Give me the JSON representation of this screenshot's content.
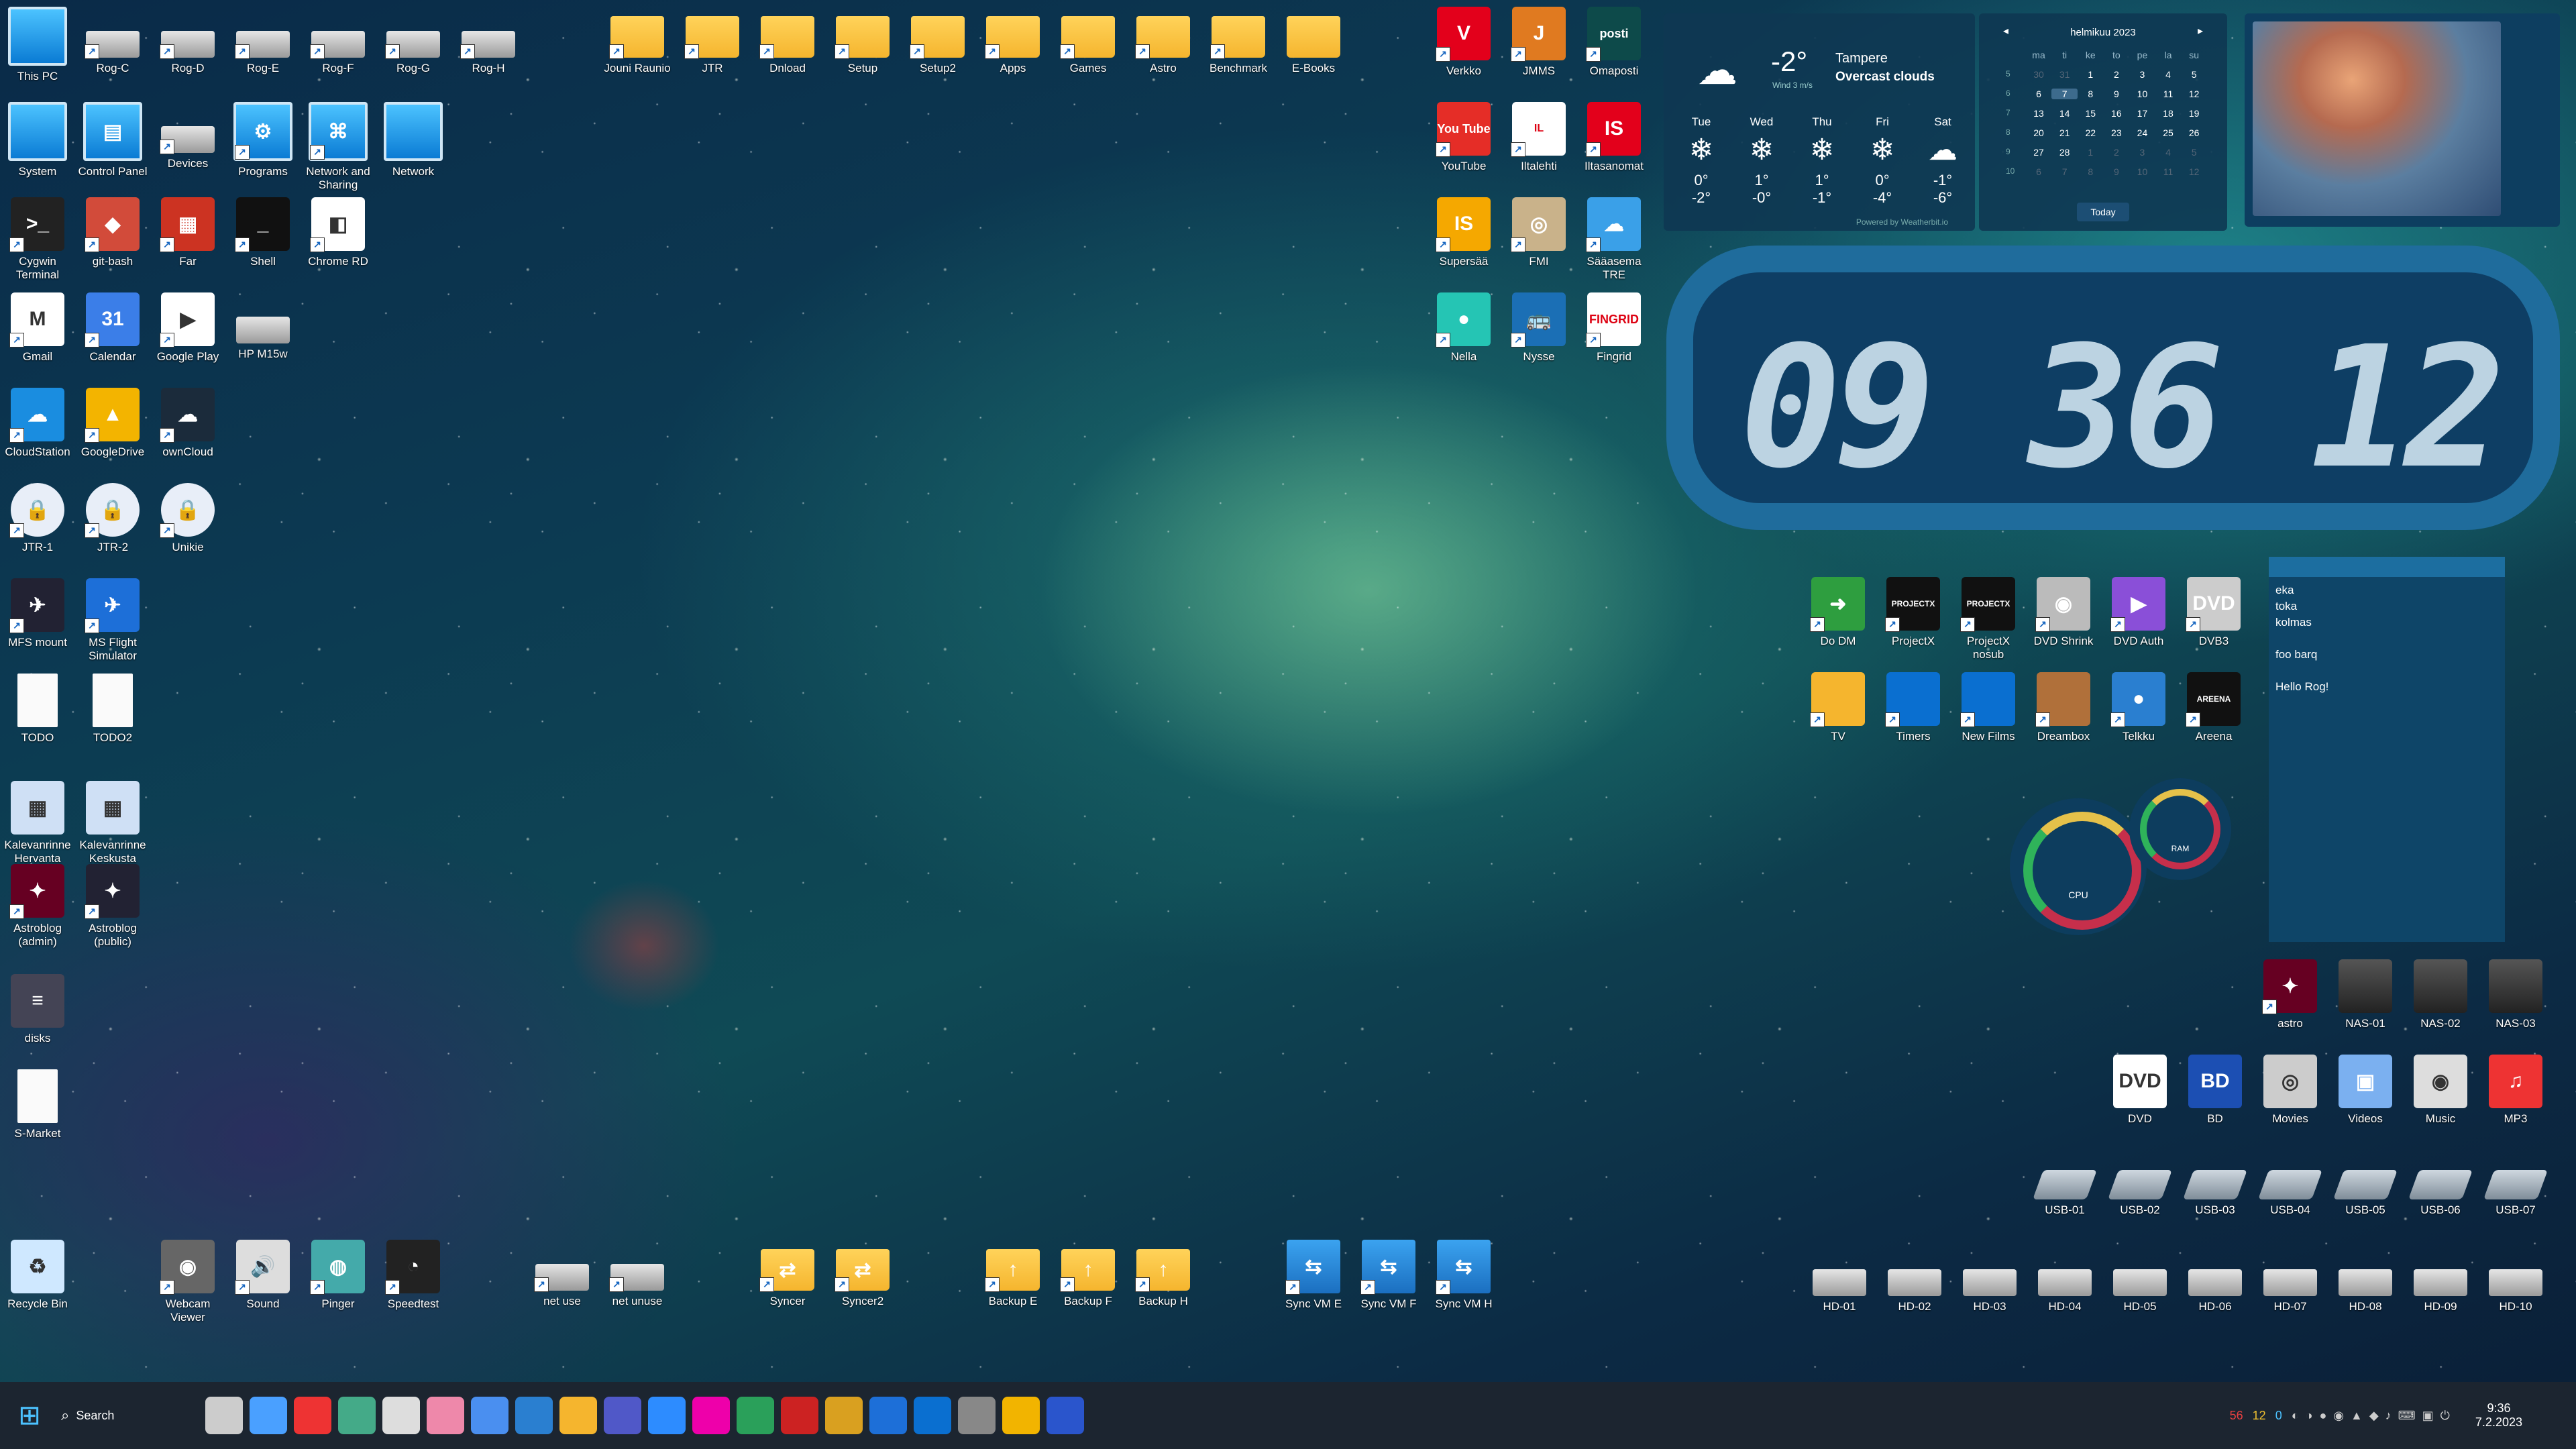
{
  "desktop": {
    "left_icons": [
      {
        "label": "This PC",
        "kind": "monitor",
        "shortcut": false
      },
      {
        "label": "Rog-C",
        "kind": "drive",
        "shortcut": true
      },
      {
        "label": "Rog-D",
        "kind": "drive",
        "shortcut": true
      },
      {
        "label": "Rog-E",
        "kind": "drive",
        "shortcut": true
      },
      {
        "label": "Rog-F",
        "kind": "drive",
        "shortcut": true
      },
      {
        "label": "Rog-G",
        "kind": "drive",
        "shortcut": true
      },
      {
        "label": "Rog-H",
        "kind": "drive",
        "shortcut": true
      },
      {
        "label": "System",
        "kind": "monitor",
        "shortcut": false
      },
      {
        "label": "Control Panel",
        "kind": "panel",
        "shortcut": false
      },
      {
        "label": "Devices",
        "kind": "devices",
        "shortcut": true
      },
      {
        "label": "Programs",
        "kind": "programs",
        "shortcut": true
      },
      {
        "label": "Network and Sharing",
        "kind": "network",
        "shortcut": true
      },
      {
        "label": "Network",
        "kind": "monitor",
        "shortcut": false
      },
      {
        "label": "Cygwin Terminal",
        "kind": "terminal",
        "shortcut": true
      },
      {
        "label": "git-bash",
        "kind": "git",
        "shortcut": true
      },
      {
        "label": "Far",
        "kind": "far",
        "shortcut": true
      },
      {
        "label": "Shell",
        "kind": "shell",
        "shortcut": true
      },
      {
        "label": "Chrome RD",
        "kind": "chromerd",
        "shortcut": true
      },
      {
        "label": "Gmail",
        "kind": "gmail",
        "shortcut": true
      },
      {
        "label": "Calendar",
        "kind": "calendar",
        "shortcut": true
      },
      {
        "label": "Google Play",
        "kind": "play",
        "shortcut": true
      },
      {
        "label": "HP M15w",
        "kind": "printer",
        "shortcut": false
      },
      {
        "label": "CloudStation",
        "kind": "cloud",
        "shortcut": true
      },
      {
        "label": "GoogleDrive",
        "kind": "gdrive",
        "shortcut": true
      },
      {
        "label": "ownCloud",
        "kind": "owncloud",
        "shortcut": true
      },
      {
        "label": "JTR-1",
        "kind": "lock",
        "shortcut": true
      },
      {
        "label": "JTR-2",
        "kind": "lock",
        "shortcut": true
      },
      {
        "label": "Unikie",
        "kind": "lock",
        "shortcut": true
      },
      {
        "label": "MFS mount",
        "kind": "mfs",
        "shortcut": true
      },
      {
        "label": "MS Flight Simulator",
        "kind": "plane",
        "shortcut": true
      },
      {
        "label": "TODO",
        "kind": "doc",
        "shortcut": false
      },
      {
        "label": "TODO2",
        "kind": "doc",
        "shortcut": false
      },
      {
        "label": "Kalevanrinne Hervanta",
        "kind": "sheet",
        "shortcut": false
      },
      {
        "label": "Kalevanrinne Keskusta",
        "kind": "sheet",
        "shortcut": false
      },
      {
        "label": "Astroblog (admin)",
        "kind": "astro",
        "shortcut": true
      },
      {
        "label": "Astroblog (public)",
        "kind": "astro2",
        "shortcut": true
      },
      {
        "label": "disks",
        "kind": "disks",
        "shortcut": false
      },
      {
        "label": "S-Market",
        "kind": "doc",
        "shortcut": false
      }
    ],
    "top_folders": [
      "Jouni Raunio",
      "JTR",
      "Dnload",
      "Setup",
      "Setup2",
      "Apps",
      "Games",
      "Astro",
      "Benchmark",
      "E-Books"
    ],
    "web_icons": [
      {
        "label": "Verkko",
        "text": "V",
        "color": "#e3001b"
      },
      {
        "label": "JMMS",
        "text": "J",
        "color": "#e07a20"
      },
      {
        "label": "Omaposti",
        "text": "posti",
        "color": "#0d4a4a"
      },
      {
        "label": "YouTube",
        "text": "You Tube",
        "color": "#e52d27"
      },
      {
        "label": "Iltalehti",
        "text": "IL",
        "color": "#ffffff"
      },
      {
        "label": "Iltasanomat",
        "text": "IS",
        "color": "#e3001b"
      },
      {
        "label": "Supersää",
        "text": "IS",
        "color": "#f5a800"
      },
      {
        "label": "FMI",
        "text": "◎",
        "color": "#c9b28a"
      },
      {
        "label": "Sääasema TRE",
        "text": "☁",
        "color": "#3aa0e8"
      },
      {
        "label": "Nella",
        "text": "●",
        "color": "#25c5b4"
      },
      {
        "label": "Nysse",
        "text": "🚌",
        "color": "#1b6fb5"
      },
      {
        "label": "Fingrid",
        "text": "FINGRID",
        "color": "#ffffff"
      }
    ],
    "media_icons": [
      {
        "label": "Do DM",
        "text": "➜",
        "color": "#2e9e3f"
      },
      {
        "label": "ProjectX",
        "text": "PROJECTX",
        "color": "#111"
      },
      {
        "label": "ProjectX nosub",
        "text": "PROJECTX",
        "color": "#111"
      },
      {
        "label": "DVD Shrink",
        "text": "◉",
        "color": "#bbb"
      },
      {
        "label": "DVD Auth",
        "text": "▶",
        "color": "#8a4fd8"
      },
      {
        "label": "DVB3",
        "text": "DVD",
        "color": "#ccc"
      },
      {
        "label": "TV",
        "text": "",
        "color": "#f5b52e"
      },
      {
        "label": "Timers",
        "text": "",
        "color": "#0a6fd0"
      },
      {
        "label": "New Films",
        "text": "",
        "color": "#0a6fd0"
      },
      {
        "label": "Dreambox",
        "text": "",
        "color": "#b0703a"
      },
      {
        "label": "Telkku",
        "text": "●",
        "color": "#2a7fd0"
      },
      {
        "label": "Areena",
        "text": "AREENA",
        "color": "#111"
      }
    ],
    "lib_icons": [
      {
        "label": "astro",
        "kind": "astro"
      },
      {
        "label": "NAS-01",
        "kind": "nas"
      },
      {
        "label": "NAS-02",
        "kind": "nas"
      },
      {
        "label": "NAS-03",
        "kind": "nas"
      },
      {
        "label": "DVD",
        "kind": "dvd"
      },
      {
        "label": "BD",
        "kind": "bd"
      },
      {
        "label": "Movies",
        "kind": "movies"
      },
      {
        "label": "Videos",
        "kind": "videos"
      },
      {
        "label": "Music",
        "kind": "music"
      },
      {
        "label": "MP3",
        "kind": "mp3"
      }
    ],
    "usb_icons": [
      "USB-01",
      "USB-02",
      "USB-03",
      "USB-04",
      "USB-05",
      "USB-06",
      "USB-07"
    ],
    "hd_icons": [
      "HD-01",
      "HD-02",
      "HD-03",
      "HD-04",
      "HD-05",
      "HD-06",
      "HD-07",
      "HD-08",
      "HD-09",
      "HD-10"
    ],
    "bottom_left": [
      {
        "label": "Recycle Bin",
        "kind": "recycle"
      },
      {
        "label": "Webcam Viewer",
        "kind": "webcam"
      },
      {
        "label": "Sound",
        "kind": "sound"
      },
      {
        "label": "Pinger",
        "kind": "pinger"
      },
      {
        "label": "Speedtest",
        "kind": "speed"
      }
    ],
    "bottom_mid": [
      {
        "label": "net use",
        "kind": "netuse"
      },
      {
        "label": "net unuse",
        "kind": "netunuse"
      },
      {
        "label": "Syncer",
        "kind": "syncer"
      },
      {
        "label": "Syncer2",
        "kind": "syncer"
      },
      {
        "label": "Backup E",
        "kind": "backup"
      },
      {
        "label": "Backup F",
        "kind": "backup"
      },
      {
        "label": "Backup H",
        "kind": "backup"
      },
      {
        "label": "Sync VM E",
        "kind": "syncvm"
      },
      {
        "label": "Sync VM F",
        "kind": "syncvm"
      },
      {
        "label": "Sync VM H",
        "kind": "syncvm"
      }
    ]
  },
  "weather": {
    "temp": "-2°",
    "city": "Tampere",
    "condition": "Overcast clouds",
    "wind": "Wind 3 m/s",
    "days": [
      {
        "day": "Tue",
        "hi": "0°",
        "lo": "-2°"
      },
      {
        "day": "Wed",
        "hi": "1°",
        "lo": "-0°"
      },
      {
        "day": "Thu",
        "hi": "1°",
        "lo": "-1°"
      },
      {
        "day": "Fri",
        "hi": "0°",
        "lo": "-4°"
      },
      {
        "day": "Sat",
        "hi": "-1°",
        "lo": "-6°"
      }
    ],
    "powered": "Powered by Weatherbit.io"
  },
  "calendar": {
    "month": "helmikuu 2023",
    "weekdays": [
      "ma",
      "ti",
      "ke",
      "to",
      "pe",
      "la",
      "su"
    ],
    "weeks": [
      {
        "wk": "5",
        "days": [
          "30",
          "31",
          "1",
          "2",
          "3",
          "4",
          "5"
        ]
      },
      {
        "wk": "6",
        "days": [
          "6",
          "7",
          "8",
          "9",
          "10",
          "11",
          "12"
        ]
      },
      {
        "wk": "7",
        "days": [
          "13",
          "14",
          "15",
          "16",
          "17",
          "18",
          "19"
        ]
      },
      {
        "wk": "8",
        "days": [
          "20",
          "21",
          "22",
          "23",
          "24",
          "25",
          "26"
        ]
      },
      {
        "wk": "9",
        "days": [
          "27",
          "28",
          "1",
          "2",
          "3",
          "4",
          "5"
        ]
      },
      {
        "wk": "10",
        "days": [
          "6",
          "7",
          "8",
          "9",
          "10",
          "11",
          "12"
        ]
      }
    ],
    "today": "7",
    "today_button": "Today",
    "prev": "◂",
    "next": "▸"
  },
  "clock": {
    "hours": "09",
    "minutes": "36",
    "seconds": "12"
  },
  "notes": {
    "lines": [
      "eka",
      "toka",
      "kolmas",
      "",
      "foo barq",
      "",
      "Hello Rog!"
    ]
  },
  "gauges": {
    "cpu_label": "CPU",
    "ram_label": "RAM",
    "cpu_level": 0.35,
    "ram_level": 0.2
  },
  "taskbar": {
    "search_label": "Search",
    "search_icon": "search-icon",
    "apps": [
      "file-explorer",
      "weather",
      "calendar-app",
      "resource-monitor",
      "clock-app",
      "snipping-tool",
      "notepad",
      "remote-desktop",
      "weather-app",
      "teams",
      "zoom",
      "slack",
      "google-drive",
      "filezilla",
      "foobar",
      "virtualbox",
      "outlook",
      "explorer2",
      "chrome",
      "terminal-app"
    ],
    "tray_numbers": {
      "a": "56",
      "b": "12",
      "c": "0"
    },
    "time": "9:36",
    "date": "7.2.2023"
  }
}
